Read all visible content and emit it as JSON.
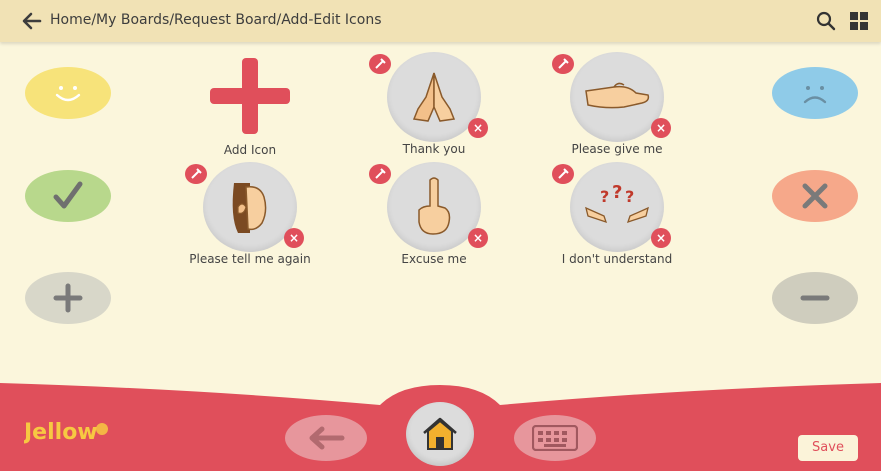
{
  "header": {
    "breadcrumb": "Home/My Boards/Request Board/Add-Edit Icons"
  },
  "icons": {
    "back": "arrow-left-icon",
    "search": "search-icon",
    "grid": "grid-icon",
    "edit": "pencil-icon",
    "delete": "close-icon"
  },
  "grid": {
    "add_label": "Add Icon",
    "tiles": [
      {
        "label": "Thank you",
        "icon": "praying-hands-icon"
      },
      {
        "label": "Please give me",
        "icon": "open-hand-icon"
      },
      {
        "label": "Please tell me again",
        "icon": "ear-cupped-icon"
      },
      {
        "label": "Excuse me",
        "icon": "raised-finger-icon"
      },
      {
        "label": "I don't understand",
        "icon": "confused-arms-icon"
      }
    ]
  },
  "left_expressions": [
    {
      "name": "like-button",
      "icon": "smiley-face-icon",
      "color": "#f7e37a"
    },
    {
      "name": "yes-button",
      "icon": "checkmark-icon",
      "color": "#b8d88c"
    },
    {
      "name": "more-button",
      "icon": "plus-icon",
      "color": "#d8d7c9"
    }
  ],
  "right_expressions": [
    {
      "name": "dislike-button",
      "icon": "sad-face-icon",
      "color": "#8fcbe8"
    },
    {
      "name": "no-button",
      "icon": "cross-icon",
      "color": "#f6a88a"
    },
    {
      "name": "less-button",
      "icon": "minus-icon",
      "color": "#cfcdbe"
    }
  ],
  "bottom": {
    "logo_text": "Jellow",
    "back_icon": "arrow-left-icon",
    "home_icon": "home-icon",
    "keyboard_icon": "keyboard-icon",
    "save_label": "Save"
  },
  "colors": {
    "topbar": "#f1e2b5",
    "background": "#fbf6dc",
    "bottom_bar": "#e04f5b",
    "accent": "#e04f5b"
  }
}
